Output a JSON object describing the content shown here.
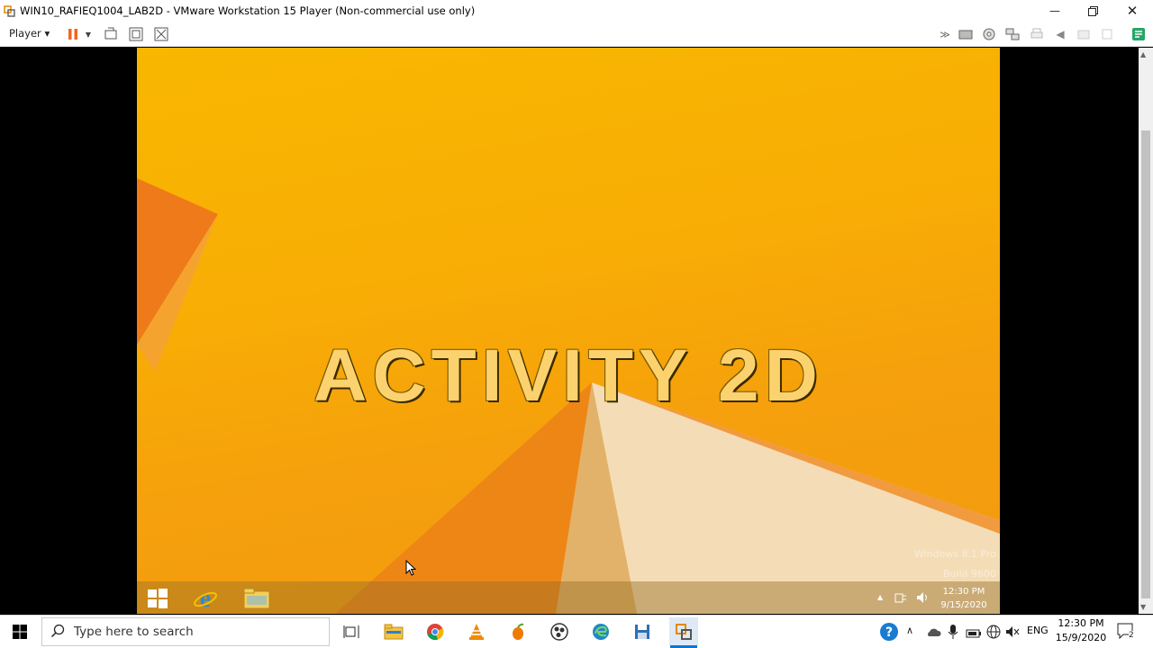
{
  "window": {
    "title": "WIN10_RAFIEQ1004_LAB2D - VMware Workstation 15 Player (Non-commercial use only)",
    "player_menu": "Player ▾"
  },
  "guest": {
    "headline": "ACTIVITY 2D",
    "watermark_line1": "Windows 8.1 Pro",
    "watermark_line2": "Build 9600",
    "clock_time": "12:30 PM",
    "clock_date": "9/15/2020"
  },
  "taskbar": {
    "search_placeholder": "Type here to search",
    "language": "ENG",
    "clock_time": "12:30 PM",
    "clock_date": "15/9/2020",
    "notification_count": "2"
  },
  "colors": {
    "wallpaper": "#f9b700",
    "headline": "#fcd26e",
    "pause_accent": "#f26522"
  }
}
